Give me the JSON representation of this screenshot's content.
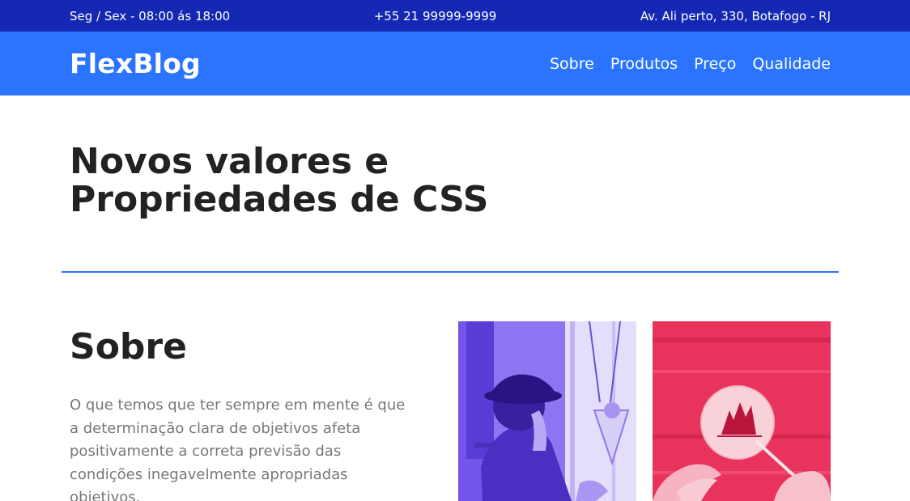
{
  "topbar": {
    "hours": "Seg / Sex - 08:00 ás 18:00",
    "phone": "+55 21 99999-9999",
    "address": "Av. Ali perto, 330, Botafogo - RJ"
  },
  "header": {
    "logo": "FlexBlog",
    "nav": [
      "Sobre",
      "Produtos",
      "Preço",
      "Qualidade"
    ]
  },
  "hero": {
    "title_line1": "Novos valores e",
    "title_line2": "Propriedades de CSS"
  },
  "about": {
    "title": "Sobre",
    "text": "O que temos que ter sempre em mente é que a determinação clara de objetivos afeta positivamente a correta previsão das condições inegavelmente apropriadas objetivos."
  },
  "colors": {
    "topbar": "#1428b4",
    "navbar": "#2a74ff",
    "photo1_tint": "#6a4be8",
    "photo2_tint": "#e8335c"
  }
}
